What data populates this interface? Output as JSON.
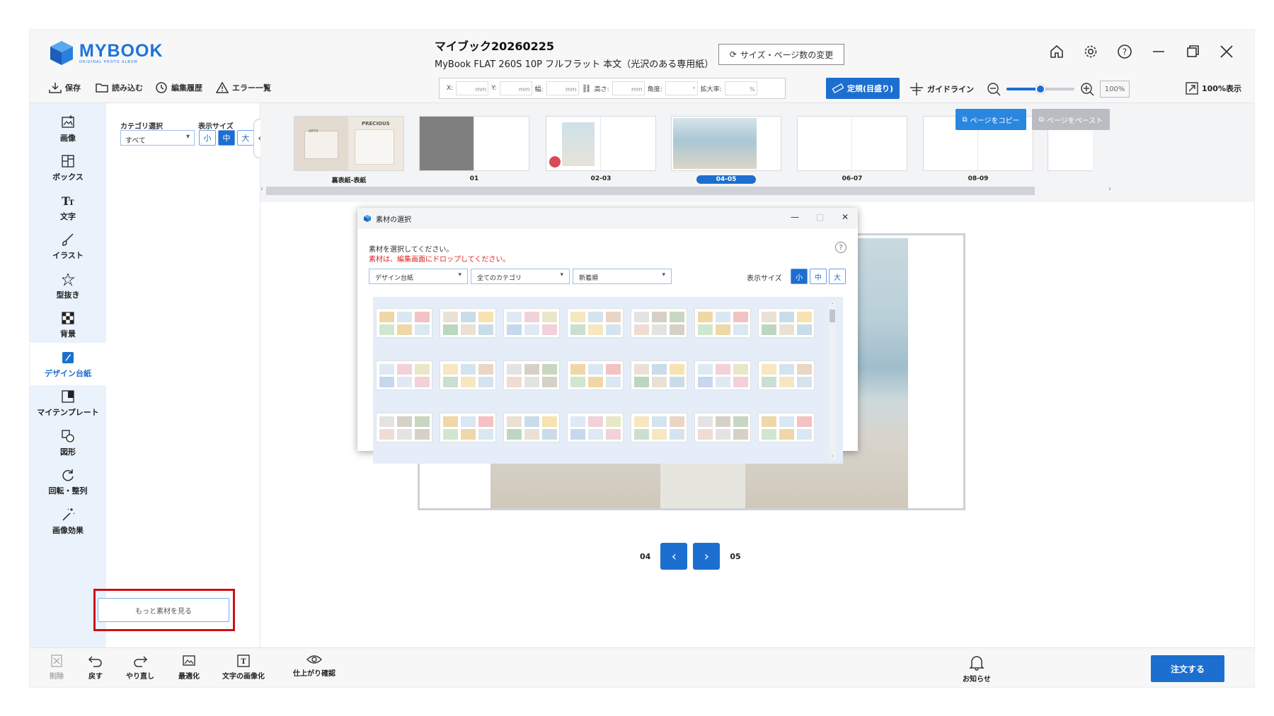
{
  "logo": {
    "main": "MYBOOK",
    "sub": "ORIGINAL PHOTO ALBUM"
  },
  "title": {
    "name": "マイブック20260225",
    "spec": "MyBook FLAT 260S 10P フルフラット 本文（光沢のある専用紙）"
  },
  "size_button": "サイズ・ページ数の変更",
  "toolbar": {
    "save": "保存",
    "load": "読み込む",
    "history": "編集履歴",
    "errors": "エラー一覧",
    "coords": {
      "x": "X:",
      "y": "Y:",
      "w": "幅:",
      "h": "高さ:",
      "angle": "角度:",
      "scale": "拡大率:",
      "unit_mm": "mm",
      "unit_deg": "°",
      "unit_pct": "%"
    },
    "ruler": "定規(目盛り)",
    "guide": "ガイドライン",
    "zoom_value": "100%",
    "zoom_level": 0.5,
    "full_view": "100%表示"
  },
  "leftnav": [
    {
      "label": "画像",
      "icon": "image-add-icon"
    },
    {
      "label": "ボックス",
      "icon": "box-layout-icon"
    },
    {
      "label": "文字",
      "icon": "text-icon"
    },
    {
      "label": "イラスト",
      "icon": "brush-icon"
    },
    {
      "label": "型抜き",
      "icon": "star-cut-icon"
    },
    {
      "label": "背景",
      "icon": "checker-icon"
    },
    {
      "label": "デザイン台紙",
      "icon": "design-mount-icon",
      "active": true
    },
    {
      "label": "マイテンプレート",
      "icon": "template-icon"
    },
    {
      "label": "図形",
      "icon": "shape-icon"
    },
    {
      "label": "回転・整列",
      "icon": "rotate-icon"
    },
    {
      "label": "画像効果",
      "icon": "magic-wand-icon"
    }
  ],
  "catpanel": {
    "category_label": "カテゴリ選択",
    "category_value": "すべて",
    "size_label": "表示サイズ",
    "sizes": [
      "小",
      "中",
      "大"
    ],
    "size_active": 1,
    "more_button": "もっと素材を見る"
  },
  "pages": [
    {
      "label": "裏表紙-表紙"
    },
    {
      "label": "01"
    },
    {
      "label": "02-03"
    },
    {
      "label": "04-05",
      "active": true
    },
    {
      "label": "06-07"
    },
    {
      "label": "08-09"
    }
  ],
  "cover_text": {
    "left": "WITH",
    "right": "PRECIOUS"
  },
  "copy_page": "ページをコピー",
  "paste_page": "ページをペースト",
  "pager": {
    "left": "04",
    "right": "05"
  },
  "dialog": {
    "title": "素材の選択",
    "message1": "素材を選択してください。",
    "message2": "素材は、編集画面にドロップしてください。",
    "selects": [
      "デザイン台紙",
      "全てのカテゴリ",
      "新着順"
    ],
    "size_label": "表示サイズ",
    "sizes": [
      "小",
      "中",
      "大"
    ],
    "size_active": 0,
    "help": "?"
  },
  "bottombar": {
    "delete": "削除",
    "undo": "戻す",
    "redo": "やり直し",
    "optimize": "最適化",
    "text_to_image": "文字の画像化",
    "preview": "仕上がり確認",
    "notice": "お知らせ",
    "order": "注文する"
  },
  "colors": {
    "accent": "#1c6fcf",
    "highlight": "#cc1016",
    "error": "#e02020"
  }
}
